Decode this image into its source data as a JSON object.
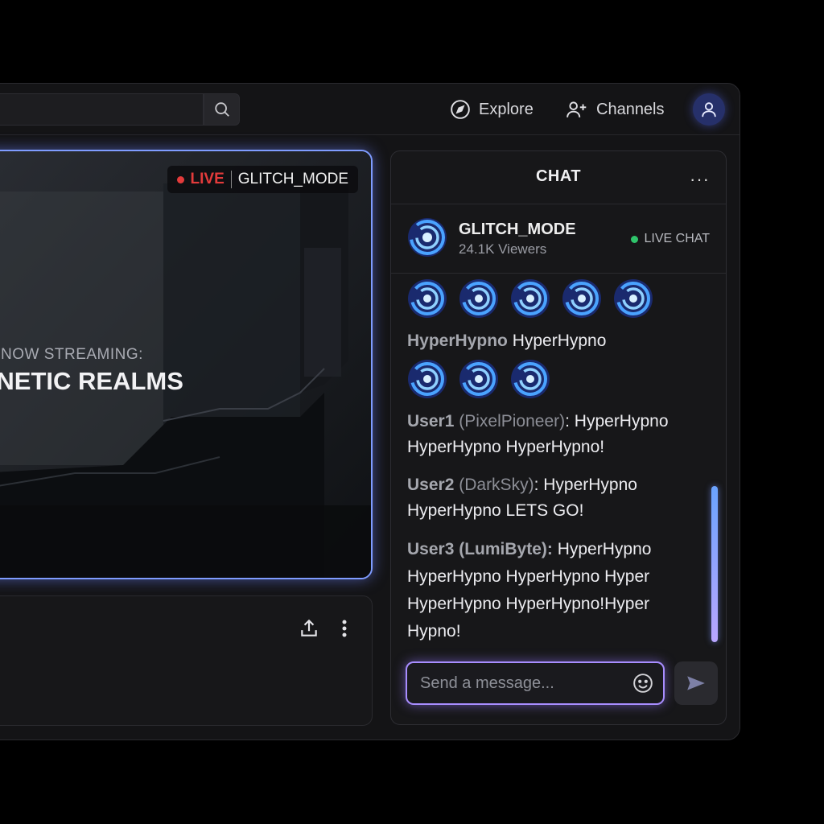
{
  "topbar": {
    "search_placeholder": "",
    "nav": [
      {
        "label": "Explore",
        "icon": "compass-icon"
      },
      {
        "label": "Channels",
        "icon": "user-plus-icon"
      }
    ]
  },
  "video": {
    "live_label": "LIVE",
    "channel": "GLITCH_MODE",
    "now_streaming": "NOW STREAMING:",
    "title": "RNETIC REALMS"
  },
  "chat": {
    "title": "CHAT",
    "menu": "···",
    "channel_name": "GLITCH_MODE",
    "viewers": "24.1K Viewers",
    "live_chat": "LIVE CHAT",
    "messages": [
      {
        "user": "HyperHypno",
        "handle": "",
        "text": " HyperHypno"
      },
      {
        "user": "User1",
        "handle": " (PixelPioneer)",
        "text": ": HyperHypno HyperHypno HyperHypno!"
      },
      {
        "user": "User2",
        "handle": " (DarkSky)",
        "text": ": HyperHypno HyperHypno LETS GO!"
      },
      {
        "user": "User3 (LumiByte):",
        "handle": "",
        "text": " HyperHypno HyperHypno HyperHypno Hyper HyperHypno HyperHypno!Hyper Hypno!"
      }
    ],
    "input_placeholder": "Send a message...",
    "accent": "#a88dff"
  },
  "colors": {
    "live_red": "#e33b3b",
    "live_green": "#2fc46b",
    "video_glow": "#7f9cff"
  }
}
